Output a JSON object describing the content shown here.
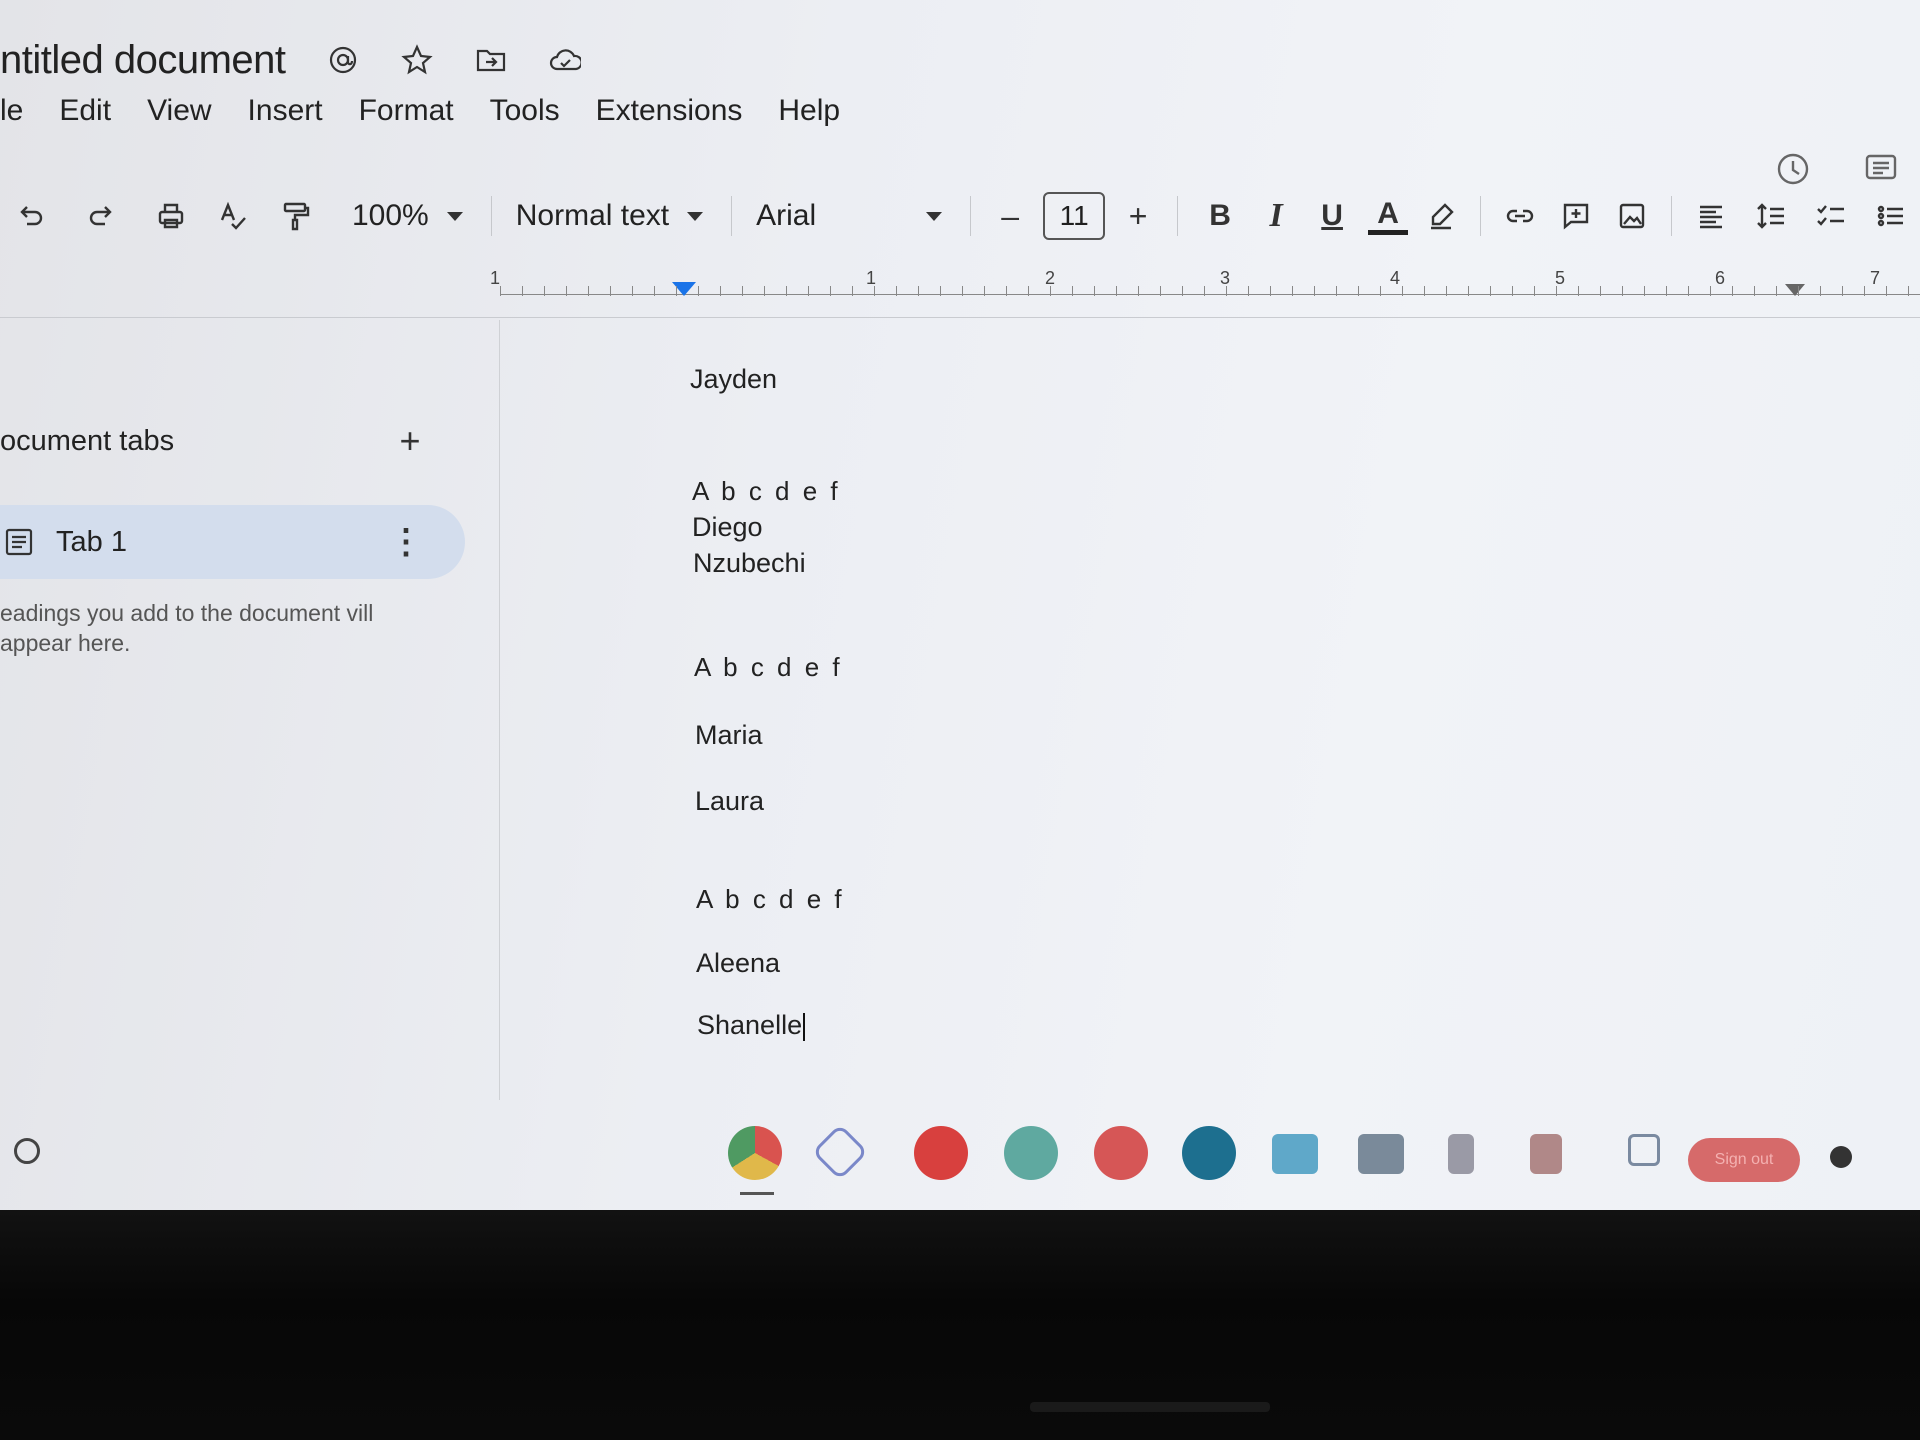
{
  "window": {
    "doc_title": "ntitled document"
  },
  "title_icons": [
    "at-icon",
    "star-icon",
    "move-folder-icon",
    "cloud-status-icon"
  ],
  "menu": [
    "le",
    "Edit",
    "View",
    "Insert",
    "Format",
    "Tools",
    "Extensions",
    "Help"
  ],
  "toolbar": {
    "zoom": "100%",
    "style": "Normal text",
    "font": "Arial",
    "font_size": "11",
    "minus": "–",
    "plus": "+",
    "bold": "B",
    "italic": "I",
    "underline": "U",
    "text_color": "A"
  },
  "ruler": {
    "labels": [
      "1",
      "1",
      "2",
      "3",
      "4",
      "5",
      "6",
      "7"
    ]
  },
  "sidebar": {
    "title": "ocument tabs",
    "add": "+",
    "tabs": [
      {
        "label": "Tab 1"
      }
    ],
    "more": "⋮",
    "hint": "eadings you add to the document vill appear here."
  },
  "document": {
    "lines": [
      "Jayden",
      "A b c d e f",
      "Diego",
      "Nzubechi",
      "A b c d e f",
      "Maria",
      "Laura",
      "A b c d e f",
      "Aleena",
      "Shanelle"
    ]
  },
  "shelf": {
    "signout_label": "Sign out",
    "app_colors": [
      "#d9534f",
      "#7a88c9",
      "#d8403e",
      "#5fa9a0",
      "#d65656",
      "#1d6f8f",
      "#5fa8c9",
      "#7a8a9a",
      "#b06060",
      "#b08888",
      "#7a8aa0"
    ]
  },
  "colors": {
    "accent": "#1a73e8",
    "tab_active_bg": "#d3dded"
  }
}
